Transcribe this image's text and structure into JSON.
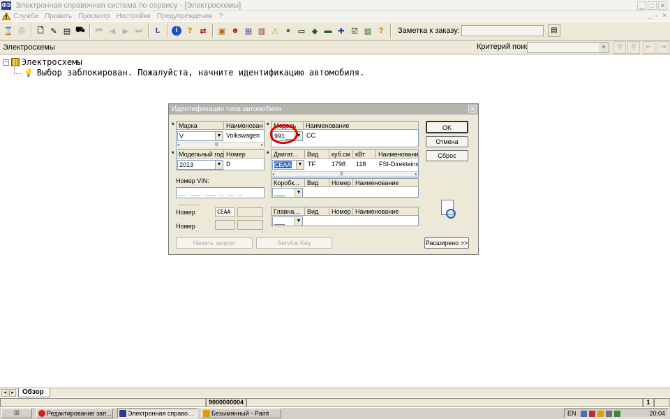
{
  "window": {
    "title": "Электронная справочная система по сервису - [Электросхемы]",
    "icon_text": "ФЭ"
  },
  "menu": {
    "items": [
      "Служба",
      "Править",
      "Просмотр",
      "Настройки",
      "Предупреждения",
      "?"
    ]
  },
  "toolbar": {
    "order_label": "Заметка к заказу:",
    "order_value": ""
  },
  "search": {
    "section_label": "Электросхемы",
    "criteria_label": "Критерий поиска:",
    "criteria_value": ""
  },
  "tree": {
    "root_label": "Электросхемы",
    "child_label": "Выбор заблокирован. Пожалуйста, начните идентификацию автомобиля."
  },
  "dialog": {
    "title": "Идентификация типа автомобиля",
    "close_glyph": "✕",
    "make": {
      "headers": [
        "Марка",
        "Наименован"
      ],
      "code": "V",
      "name": "Volkswagen"
    },
    "model": {
      "headers": [
        "Модель",
        "Наименование"
      ],
      "code": "991__",
      "name": "CC"
    },
    "year": {
      "headers": [
        "Модельный год",
        "Номер"
      ],
      "value": "2013",
      "number": "D"
    },
    "engine": {
      "headers": [
        "Двигат...",
        "Вид",
        "куб.см",
        "кВт",
        "Наименование"
      ],
      "code": "CEAA",
      "type": "TF",
      "cc": "1798",
      "kw": "118",
      "name": "FSI-Direkteins"
    },
    "gearbox": {
      "headers": [
        "Коробк...",
        "Вид",
        "Номер",
        "Наименование"
      ],
      "code": "___"
    },
    "final_drive": {
      "headers": [
        "Главна...",
        "Вид",
        "Номер",
        "Наименование"
      ],
      "code": "___"
    },
    "vin": {
      "label": "Номер VIN:",
      "value": "__ ___ ___ _ __ _ ______"
    },
    "number_label_1": "Номер",
    "number_value_1": "CEAA",
    "number_label_2": "Номер",
    "buttons": {
      "ok": "OK",
      "cancel": "Отмена",
      "reset": "Сброс",
      "start_query": "Начать запрос",
      "service_key": "Service Key",
      "advanced": "Расширено >>"
    }
  },
  "bottom": {
    "tab_label": "Обзор",
    "status_code": "9000000004",
    "status_page": "1"
  },
  "taskbar": {
    "tasks": [
      {
        "label": "Редактирование зап...",
        "color": "#d02020"
      },
      {
        "label": "Электронная справо...",
        "color": "#2a3a8c"
      },
      {
        "label": "Безымянный - Paint",
        "color": "#e0a000"
      }
    ],
    "lang": "EN",
    "clock": "20:04"
  },
  "colors": {
    "annotation": "#e00000",
    "dialog_title_bg": "#b5b3ae",
    "toolbar_bg": "#ece9d8"
  }
}
